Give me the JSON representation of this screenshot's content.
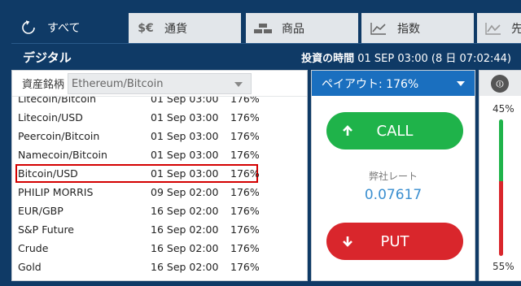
{
  "tabs": [
    {
      "label": "すべて",
      "icon": "refresh-icon"
    },
    {
      "label": "通貨",
      "icon": "currency-icon",
      "icon_text": "$€"
    },
    {
      "label": "商品",
      "icon": "commodity-icon"
    },
    {
      "label": "指数",
      "icon": "index-chart-icon"
    },
    {
      "label": "先",
      "icon": "futures-chart-icon"
    }
  ],
  "header": {
    "title": "デジタル",
    "server_label": "投資の時間",
    "server_time": "01 SEP 03:00 (8 日 07:02:44)"
  },
  "asset_select": {
    "label": "資産銘柄",
    "value": "Ethereum/Bitcoin"
  },
  "assets": [
    {
      "name": "Litecoin/Bitcoin",
      "time": "01 Sep 03:00",
      "payout": "176%"
    },
    {
      "name": "Litecoin/USD",
      "time": "01 Sep 03:00",
      "payout": "176%"
    },
    {
      "name": "Peercoin/Bitcoin",
      "time": "01 Sep 03:00",
      "payout": "176%"
    },
    {
      "name": "Namecoin/Bitcoin",
      "time": "01 Sep 03:00",
      "payout": "176%"
    },
    {
      "name": "Bitcoin/USD",
      "time": "01 Sep 03:00",
      "payout": "176%",
      "selected": true
    },
    {
      "name": "PHILIP MORRIS",
      "time": "09 Sep 02:00",
      "payout": "176%"
    },
    {
      "name": "EUR/GBP",
      "time": "16 Sep 02:00",
      "payout": "176%"
    },
    {
      "name": "S&P Future",
      "time": "16 Sep 02:00",
      "payout": "176%"
    },
    {
      "name": "Crude",
      "time": "16 Sep 02:00",
      "payout": "176%"
    },
    {
      "name": "Gold",
      "time": "16 Sep 02:00",
      "payout": "176%"
    }
  ],
  "trade": {
    "payout_label": "ペイアウト:  176%",
    "call_label": "CALL",
    "put_label": "PUT",
    "rate_label": "弊社レート",
    "rate_value": "0.07617"
  },
  "sentiment": {
    "call_pct": "45%",
    "put_pct": "55%",
    "call_fraction": 0.45,
    "colors": {
      "call": "#1fb34a",
      "put": "#d9262c"
    }
  }
}
